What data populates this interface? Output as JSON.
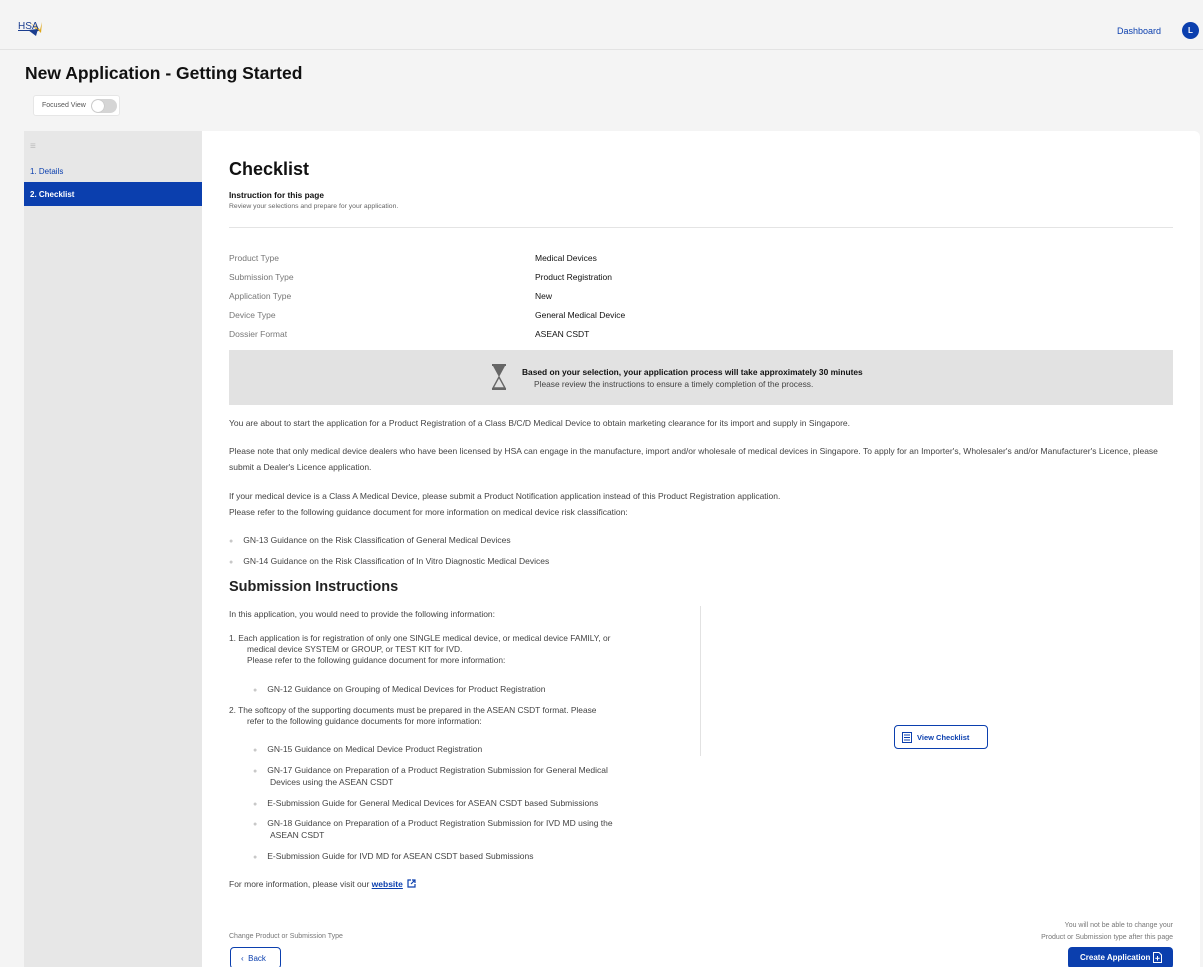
{
  "header": {
    "logo_text": "HSA",
    "nav_dashboard": "Dashboard",
    "avatar_initial": "L"
  },
  "page_title": "New Application - Getting Started",
  "focused_view": {
    "label": "Focused View",
    "enabled": false
  },
  "sidebar": {
    "menu_icon": "hamburger-icon",
    "items": [
      {
        "label": "1.  Details",
        "active": false
      },
      {
        "label": "2.  Checklist",
        "active": true
      }
    ]
  },
  "main": {
    "title": "Checklist",
    "instruction_title": "Instruction for this page",
    "instruction_sub": "Review your selections and prepare for your application.",
    "selections": [
      {
        "label": "Product Type",
        "value": "Medical Devices"
      },
      {
        "label": "Submission Type",
        "value": "Product Registration"
      },
      {
        "label": "Application Type",
        "value": "New"
      },
      {
        "label": "Device Type",
        "value": "General Medical Device"
      },
      {
        "label": "Dossier Format",
        "value": "ASEAN CSDT"
      }
    ],
    "estimate": {
      "main": "Based on your selection, your application process will take approximately 30 minutes",
      "sub": "Please review the instructions to ensure a timely completion of the process."
    },
    "paragraphs": [
      "You are about to start the application for a Product Registration of a Class B/C/D Medical Device to obtain marketing clearance for its import and supply in Singapore.",
      "Please note that only medical device dealers who have been licensed by HSA can engage in the manufacture, import and/or wholesale of medical devices in Singapore. To apply for an Importer's, Wholesaler's and/or Manufacturer's Licence, please submit a Dealer's Licence application.",
      "If your medical device is a Class A Medical Device, please submit a Product Notification application instead of this Product Registration application.",
      "Please refer to the following guidance document for more information on medical device risk classification:"
    ],
    "risk_docs": [
      "GN-13 Guidance on the Risk Classification of General Medical Devices",
      "GN-14 Guidance on the Risk Classification of In Vitro Diagnostic Medical Devices"
    ],
    "submission": {
      "heading": "Submission Instructions",
      "intro": "In this application, you would need to provide the following information:",
      "item1_lines": [
        "1.  Each application is for registration of only one SINGLE medical device, or medical device FAMILY, or",
        "medical device SYSTEM or GROUP, or TEST KIT for IVD.",
        "Please refer to the following guidance document for more information:"
      ],
      "item1_docs": [
        "GN-12 Guidance on Grouping of Medical Devices for Product Registration"
      ],
      "item2_lines": [
        "2.  The softcopy of the supporting documents must be prepared in the ASEAN CSDT format. Please",
        "refer to the following guidance documents for more information:"
      ],
      "item2_docs": [
        "GN-15 Guidance on Medical Device Product Registration",
        "GN-17 Guidance on Preparation of a Product Registration Submission for General Medical",
        "Devices using the ASEAN CSDT",
        "E-Submission Guide for General Medical Devices for ASEAN CSDT based Submissions",
        "GN-18 Guidance on Preparation of a Product Registration Submission for IVD MD using the",
        "ASEAN CSDT",
        "E-Submission Guide for IVD MD for ASEAN CSDT based Submissions"
      ],
      "view_checklist": "View Checklist"
    },
    "website_prefix": "For more information, please visit our ",
    "website_link": "website",
    "change_text": "Change Product or Submission Type",
    "back_label": "Back",
    "warning_lines": [
      "You will not be able to change your",
      "Product or Submission type after this page"
    ],
    "create_label": "Create Application"
  },
  "colors": {
    "accent": "#0b3fae",
    "estimate_bg": "#e2e2e2",
    "sidebar_bg": "#e7e7e7"
  }
}
